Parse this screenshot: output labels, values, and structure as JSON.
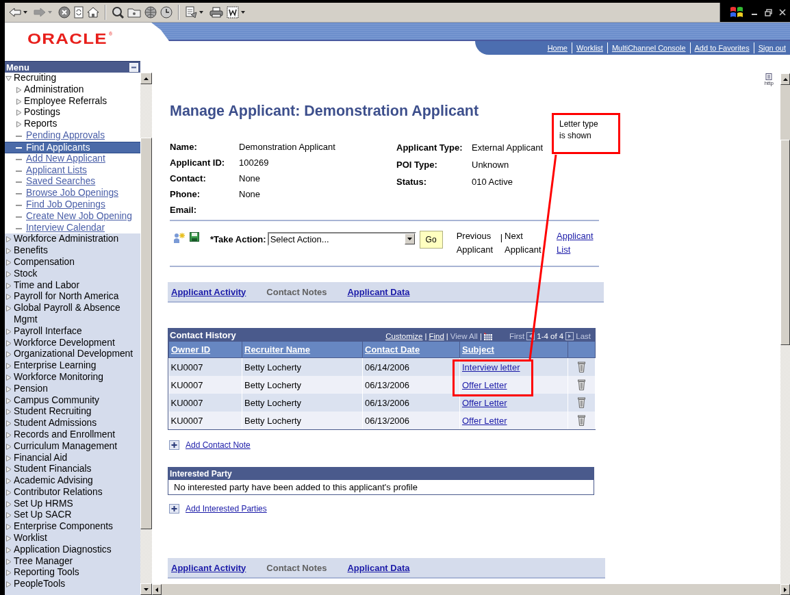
{
  "header": {
    "logo": "ORACLE",
    "registered_mark": "®",
    "links": [
      "Home",
      "Worklist",
      "MultiChannel Console",
      "Add to Favorites",
      "Sign out"
    ]
  },
  "menu": {
    "title": "Menu",
    "items": [
      {
        "label": "Recruiting",
        "expanded": true,
        "children": [
          {
            "label": "Administration",
            "kind": "folder",
            "expanded": false
          },
          {
            "label": "Employee Referrals",
            "kind": "folder",
            "expanded": false
          },
          {
            "label": "Postings",
            "kind": "folder",
            "expanded": false
          },
          {
            "label": "Reports",
            "kind": "folder",
            "expanded": false
          },
          {
            "label": "Pending Approvals",
            "kind": "link",
            "selected": false
          },
          {
            "label": "Find Applicants",
            "kind": "link",
            "selected": true
          },
          {
            "label": "Add New Applicant",
            "kind": "link",
            "selected": false
          },
          {
            "label": "Applicant Lists",
            "kind": "link",
            "selected": false
          },
          {
            "label": "Saved Searches",
            "kind": "link",
            "selected": false
          },
          {
            "label": "Browse Job Openings",
            "kind": "link",
            "selected": false
          },
          {
            "label": "Find Job Openings",
            "kind": "link",
            "selected": false
          },
          {
            "label": "Create New Job Opening",
            "kind": "link",
            "selected": false
          },
          {
            "label": "Interview Calendar",
            "kind": "link",
            "selected": false
          }
        ]
      },
      {
        "label": "Workforce Administration",
        "expanded": false
      },
      {
        "label": "Benefits",
        "expanded": false
      },
      {
        "label": "Compensation",
        "expanded": false
      },
      {
        "label": "Stock",
        "expanded": false
      },
      {
        "label": "Time and Labor",
        "expanded": false
      },
      {
        "label": "Payroll for North America",
        "expanded": false
      },
      {
        "label": "Global Payroll & Absence Mgmt",
        "expanded": false
      },
      {
        "label": "Payroll Interface",
        "expanded": false
      },
      {
        "label": "Workforce Development",
        "expanded": false
      },
      {
        "label": "Organizational Development",
        "expanded": false
      },
      {
        "label": "Enterprise Learning",
        "expanded": false
      },
      {
        "label": "Workforce Monitoring",
        "expanded": false
      },
      {
        "label": "Pension",
        "expanded": false
      },
      {
        "label": "Campus Community",
        "expanded": false
      },
      {
        "label": "Student Recruiting",
        "expanded": false
      },
      {
        "label": "Student Admissions",
        "expanded": false
      },
      {
        "label": "Records and Enrollment",
        "expanded": false
      },
      {
        "label": "Curriculum Management",
        "expanded": false
      },
      {
        "label": "Financial Aid",
        "expanded": false
      },
      {
        "label": "Student Financials",
        "expanded": false
      },
      {
        "label": "Academic Advising",
        "expanded": false
      },
      {
        "label": "Contributor Relations",
        "expanded": false
      },
      {
        "label": "Set Up HRMS",
        "expanded": false
      },
      {
        "label": "Set Up SACR",
        "expanded": false
      },
      {
        "label": "Enterprise Components",
        "expanded": false
      },
      {
        "label": "Worklist",
        "expanded": false
      },
      {
        "label": "Application Diagnostics",
        "expanded": false
      },
      {
        "label": "Tree Manager",
        "expanded": false
      },
      {
        "label": "Reporting Tools",
        "expanded": false
      },
      {
        "label": "PeopleTools",
        "expanded": false
      }
    ]
  },
  "http_icon": {
    "label": "http"
  },
  "title": "Manage Applicant: Demonstration Applicant",
  "applicant": {
    "left": [
      {
        "label": "Name:",
        "value": "Demonstration Applicant"
      },
      {
        "label": "Applicant ID:",
        "value": "100269"
      },
      {
        "label": "Contact:",
        "value": "None"
      },
      {
        "label": "Phone:",
        "value": "None"
      },
      {
        "label": "Email:"
      }
    ],
    "right": [
      {
        "label": "Applicant Type:",
        "value": "External Applicant"
      },
      {
        "label": "POI Type:",
        "value": "Unknown"
      },
      {
        "label": "Status:",
        "value": "010 Active"
      }
    ]
  },
  "action_bar": {
    "label": "*Take Action:",
    "select": "Select Action...",
    "button": "Go",
    "previous": "Previous Applicant",
    "separator": "|",
    "next": "Next Applicant",
    "list_link": "Applicant List"
  },
  "top_tabs": [
    {
      "label": "Applicant Activity",
      "selected": false
    },
    {
      "label": "Contact Notes",
      "selected": true
    },
    {
      "label": "Applicant Data",
      "selected": false
    }
  ],
  "contact_history": {
    "title": "Contact History",
    "tools": [
      {
        "label": "Customize",
        "kind": "link"
      },
      {
        "label": "|",
        "kind": "separator"
      },
      {
        "label": "Find",
        "kind": "link"
      },
      {
        "label": "|",
        "kind": "separator"
      },
      {
        "label": "View All",
        "kind": "disabled"
      },
      {
        "label": "|",
        "kind": "separator"
      }
    ],
    "first": "First",
    "range": "1-4 of 4",
    "last": "Last",
    "columns": [
      "Owner ID",
      "Recruiter Name",
      "Contact Date",
      "Subject"
    ],
    "rows": [
      {
        "owner_id": "KU0007",
        "recruiter_name": "Betty Locherty",
        "contact_date": "06/14/2006",
        "subject": "Interview letter"
      },
      {
        "owner_id": "KU0007",
        "recruiter_name": "Betty Locherty",
        "contact_date": "06/13/2006",
        "subject": "Offer Letter"
      },
      {
        "owner_id": "KU0007",
        "recruiter_name": "Betty Locherty",
        "contact_date": "06/13/2006",
        "subject": "Offer Letter"
      },
      {
        "owner_id": "KU0007",
        "recruiter_name": "Betty Locherty",
        "contact_date": "06/13/2006",
        "subject": "Offer Letter"
      }
    ]
  },
  "add_contact_note": "Add Contact Note",
  "interested_party": {
    "title": "Interested Party",
    "message": "No interested party have been added to this applicant's profile"
  },
  "add_interested_parties": "Add Interested Parties",
  "bottom_tabs": [
    {
      "label": "Applicant Activity",
      "selected": false
    },
    {
      "label": "Contact Notes",
      "selected": true
    },
    {
      "label": "Applicant Data",
      "selected": false
    }
  ],
  "callout": {
    "text": "Letter type is shown"
  }
}
